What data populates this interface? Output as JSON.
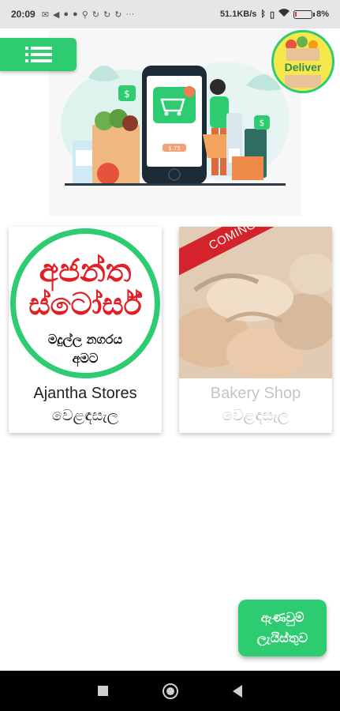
{
  "status_bar": {
    "time": "20:09",
    "network_speed": "51.1KB/s",
    "battery_percent": "8%",
    "battery_level": 0.08,
    "left_icons": [
      "mail-icon",
      "volume-icon",
      "messenger-icon",
      "messenger-icon",
      "usb-icon",
      "sync-icon",
      "sync-icon",
      "sync-icon",
      "more-dots-icon"
    ],
    "right_icons": [
      "bluetooth-icon",
      "vibrate-icon",
      "wifi-icon",
      "battery-icon"
    ]
  },
  "header": {
    "menu_icon": "hamburger-menu-icon",
    "deliver_label": "Deliver"
  },
  "hero": {
    "illustration": "online-grocery-shopping-illustration",
    "phone_price_tag": "$.75"
  },
  "stores": [
    {
      "logo_line1": "අජන්ත",
      "logo_line2": "ස්ටෝර්ස්",
      "logo_line3": "මදුල්ල නගරය",
      "logo_line4": "අමට",
      "name": "Ajantha Stores",
      "subtitle": "වෙළඳසැල",
      "enabled": true
    },
    {
      "ribbon": "COMING SOON",
      "name": "Bakery Shop",
      "subtitle": "වෙළඳසැල",
      "enabled": false
    }
  ],
  "fab": {
    "line1": "ඇණවුම්",
    "line2": "ලැයිස්තුව"
  },
  "colors": {
    "accent_green": "#2ecc71",
    "logo_red": "#e31e24",
    "ribbon_red": "#d4232a",
    "badge_yellow": "#f6e84a"
  }
}
